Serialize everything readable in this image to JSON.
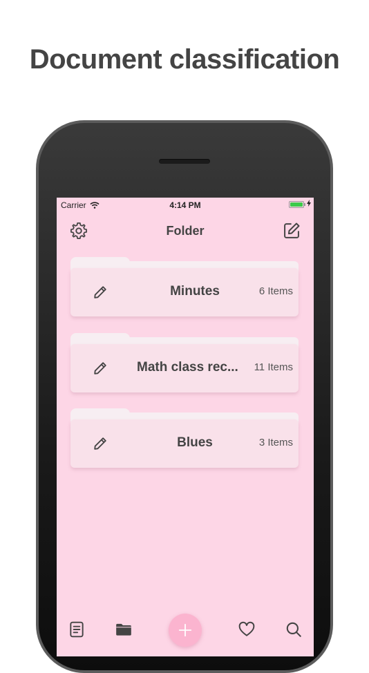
{
  "headline": "Document classification",
  "status_bar": {
    "carrier": "Carrier",
    "time": "4:14 PM"
  },
  "nav": {
    "title": "Folder",
    "left_icon": "gear-icon",
    "right_icon": "compose-icon"
  },
  "folders": [
    {
      "name": "Minutes",
      "count": "6 Items"
    },
    {
      "name": "Math class rec...",
      "count": "11 Items"
    },
    {
      "name": "Blues",
      "count": "3 Items"
    }
  ],
  "tab_bar": {
    "items": [
      "document-icon",
      "folder-icon",
      "plus-icon",
      "heart-icon",
      "search-icon"
    ]
  },
  "colors": {
    "screen_bg": "#fdd6e6",
    "folder_front": "#f9e1ea",
    "folder_back": "#f7eef2",
    "accent": "#fbb4cf",
    "text": "#444444"
  }
}
